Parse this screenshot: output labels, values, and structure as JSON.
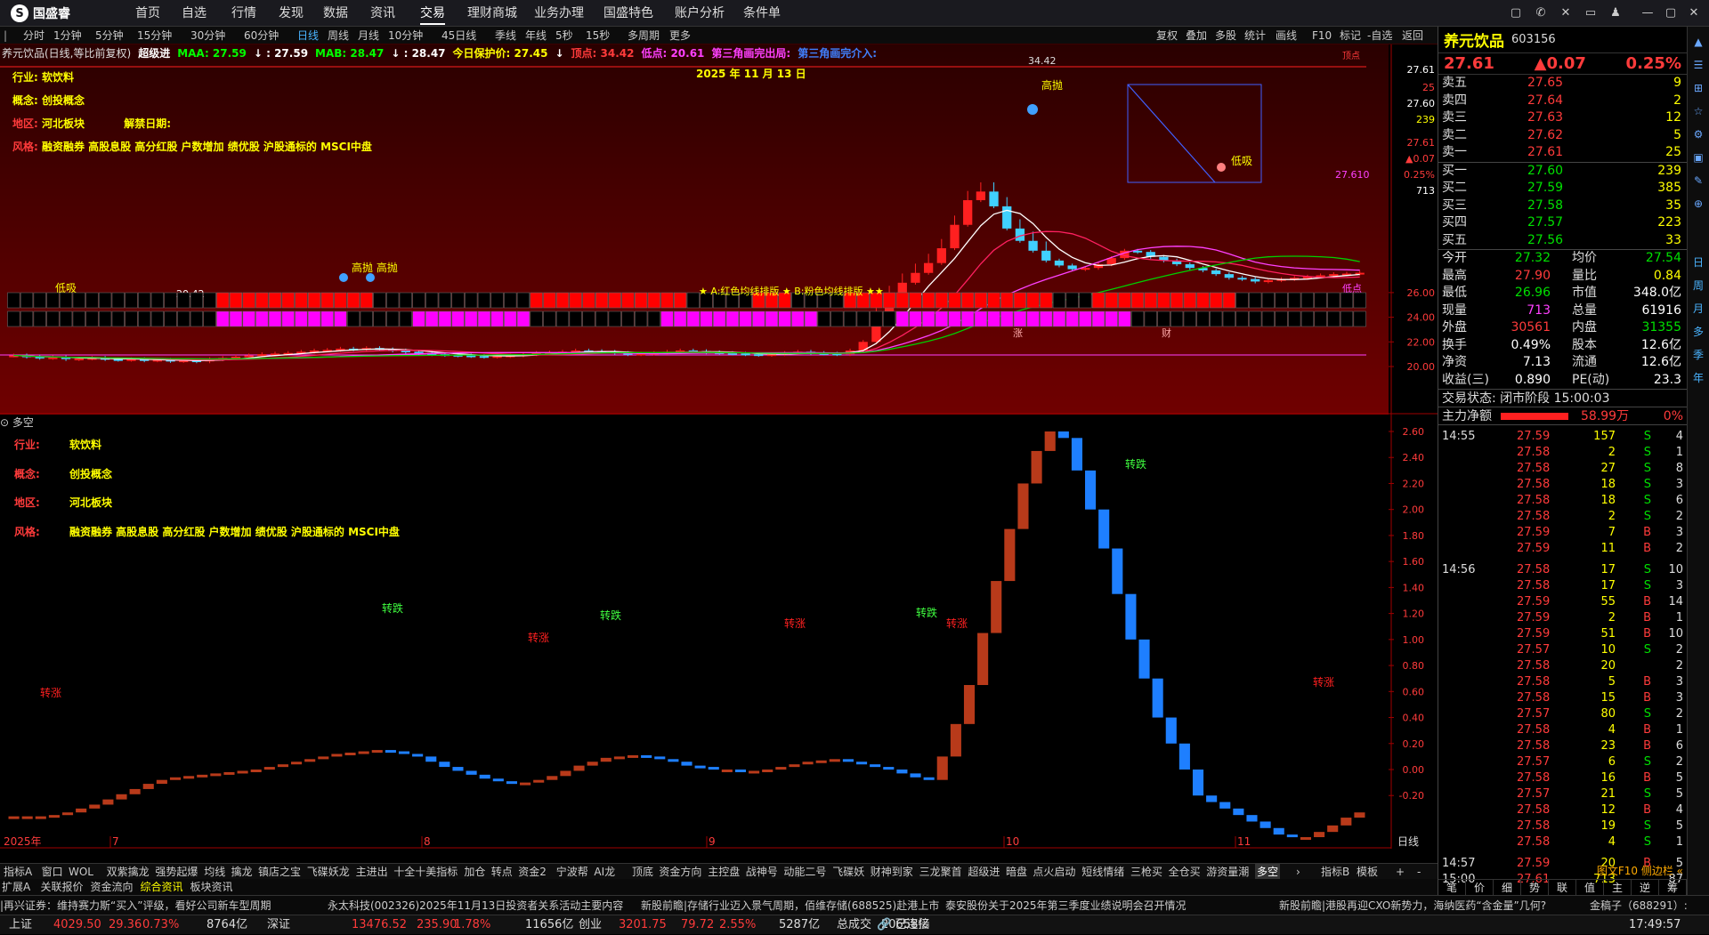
{
  "app": {
    "logo": "国盛睿"
  },
  "nav": [
    "首页",
    "自选",
    "行情",
    "发现",
    "数据",
    "资讯",
    "交易",
    "理财商城",
    "业务办理",
    "国盛特色",
    "账户分析",
    "条件单"
  ],
  "nav_active": "交易",
  "periods": [
    "分时",
    "1分钟",
    "5分钟",
    "15分钟",
    "30分钟",
    "60分钟",
    "日线",
    "周线",
    "月线",
    "10分钟",
    "45日线",
    "季线",
    "年线",
    "5秒",
    "15秒",
    "多周期",
    "更多"
  ],
  "period_active": "日线",
  "toolbar": [
    "复权",
    "叠加",
    "多股",
    "统计",
    "画线",
    "F10",
    "标记",
    "-自选",
    "返回"
  ],
  "chart_title": "养元饮品(日线,等比前复权)",
  "indicator_line": [
    {
      "t": "超级进",
      "c": "#ffffff"
    },
    {
      "t": "MAA: 27.59",
      "c": "#00ff00"
    },
    {
      "t": "↓ : 27.59",
      "c": "#ffffff"
    },
    {
      "t": "MAB: 28.47",
      "c": "#00ff00"
    },
    {
      "t": "↓ : 28.47",
      "c": "#ffffff"
    },
    {
      "t": "今日保护价: 27.45",
      "c": "#ffff00"
    },
    {
      "t": "↓",
      "c": "#ffffff"
    },
    {
      "t": "顶点: 34.42",
      "c": "#ff3b3b"
    },
    {
      "t": "低点: 20.61",
      "c": "#ff40ff"
    },
    {
      "t": "第三角画完出局:",
      "c": "#ff40ff"
    },
    {
      "t": "第三角画完介入:",
      "c": "#4080ff"
    }
  ],
  "info_block": {
    "labels": {
      "industry": "行业:",
      "concept": "概念:",
      "region": "地区:",
      "unban": "解禁日期:",
      "style": "风格:"
    },
    "industry": "软饮料",
    "concept": "创投概念",
    "region": "河北板块",
    "style": "融资融券 高股息股 高分红股 户数增加 绩优股 沪股通标的 MSCI中盘"
  },
  "date_label": "2025 年 11 月 13 日",
  "annotations": {
    "peak": "34.42",
    "low_val": "20.42",
    "high_sell": "高抛",
    "high_sell2": "高抛 高抛",
    "low_buy": "低吸",
    "last_price": "27.610",
    "pattern": "★ A:红色均线排版 ★ B:粉色均线排版 ★★",
    "top_mark": "顶点",
    "bottom_mark": "低点",
    "zhang": "涨",
    "cai": "财"
  },
  "price_axis": [
    "27.61",
    "25",
    "27.60",
    "239",
    "27.61",
    "▲0.07",
    "0.25%",
    "713",
    "26.00",
    "24.00",
    "22.00",
    "20.00"
  ],
  "lower": {
    "title": "多空",
    "axis": [
      "2.60",
      "2.40",
      "2.20",
      "2.00",
      "1.80",
      "1.60",
      "1.40",
      "1.20",
      "1.00",
      "0.80",
      "0.60",
      "0.40",
      "0.20",
      "0.00",
      "-0.20"
    ],
    "turn_down": "转跌",
    "turn_up": "转涨"
  },
  "months": [
    "2025年",
    "7",
    "8",
    "9",
    "10",
    "11"
  ],
  "indicator_tabs": [
    "指标A",
    "窗口",
    "WOL",
    "双紫擒龙",
    "强势起爆",
    "均线",
    "擒龙",
    "镇店之宝",
    "飞碟妖龙",
    "主进出",
    "十全十美指标",
    "加仓",
    "转点",
    "资金2",
    "宁波帮",
    "AI龙",
    "顶底",
    "资金方向",
    "主控盘",
    "战神号",
    "动能二号",
    "飞碟妖",
    "财神到家",
    "三龙聚首",
    "超级进",
    "暗盘",
    "点火启动",
    "短线情绪",
    "三枪买",
    "全仓买",
    "游资量潮",
    "多空",
    "指标B",
    "模板"
  ],
  "sub_tabs": [
    "扩展A",
    "关联报价",
    "资金流向",
    "综合资讯",
    "板块资讯"
  ],
  "news": [
    "|再兴证券：维持赛力斯“买入”评级，看好公司新车型周期",
    "永太科技(002326)2025年11月13日投资者关系活动主要内容",
    "新股前瞻|存储行业迈入景气周期，佰维存储(688525)赴港上市能否破",
    "泰安股份关于2025年第三季度业绩说明会召开情况",
    "新股前瞻|港股再迎CXO新势力，海纳医药“含金量”几何?",
    "金稿子（688291）:"
  ],
  "status": [
    {
      "n": "上证",
      "v": "4029.50",
      "c": "29.36",
      "p": "0.73%",
      "a": "8764亿"
    },
    {
      "n": "深证",
      "v": "13476.52",
      "c": "235.90",
      "p": "1.78%",
      "a": "11656亿"
    },
    {
      "n": "创业",
      "v": "3201.75",
      "c": "79.72",
      "p": "2.55%",
      "a": "5287亿"
    }
  ],
  "status_total_label": "总成交",
  "status_total": "20658亿",
  "connected": "已连接",
  "clock": "17:49:57",
  "quote": {
    "name": "养元饮品",
    "code": "603156",
    "price": "27.61",
    "change": "▲0.07",
    "pct": "0.25%",
    "asks": [
      [
        "卖五",
        "27.65",
        "9"
      ],
      [
        "卖四",
        "27.64",
        "2"
      ],
      [
        "卖三",
        "27.63",
        "12"
      ],
      [
        "卖二",
        "27.62",
        "5"
      ],
      [
        "卖一",
        "27.61",
        "25"
      ]
    ],
    "bids": [
      [
        "买一",
        "27.60",
        "239"
      ],
      [
        "买二",
        "27.59",
        "385"
      ],
      [
        "买三",
        "27.58",
        "35"
      ],
      [
        "买四",
        "27.57",
        "223"
      ],
      [
        "买五",
        "27.56",
        "33"
      ]
    ],
    "stats": [
      [
        "今开",
        "27.32",
        "均价",
        "27.54"
      ],
      [
        "最高",
        "27.90",
        "量比",
        "0.84"
      ],
      [
        "最低",
        "26.96",
        "市值",
        "348.0亿"
      ],
      [
        "现量",
        "713",
        "总量",
        "61916"
      ],
      [
        "外盘",
        "30561",
        "内盘",
        "31355"
      ],
      [
        "换手",
        "0.49%",
        "股本",
        "12.6亿"
      ],
      [
        "净资",
        "7.13",
        "流通",
        "12.6亿"
      ],
      [
        "收益(三)",
        "0.890",
        "PE(动)",
        "23.3"
      ]
    ],
    "trade_state": "交易状态: 闭市阶段 15:00:03",
    "mainflow_label": "主力净额",
    "mainflow": "58.99万",
    "mainflow_pct": "0%",
    "ticks": [
      [
        "14:55",
        "27.59",
        "157",
        "S",
        "4"
      ],
      [
        "",
        "27.58",
        "2",
        "S",
        "1"
      ],
      [
        "",
        "27.58",
        "27",
        "S",
        "8"
      ],
      [
        "",
        "27.58",
        "18",
        "S",
        "3"
      ],
      [
        "",
        "27.58",
        "18",
        "S",
        "6"
      ],
      [
        "",
        "27.58",
        "2",
        "S",
        "2"
      ],
      [
        "",
        "27.59",
        "7",
        "B",
        "3"
      ],
      [
        "",
        "27.59",
        "11",
        "B",
        "2"
      ],
      [
        "14:56",
        "27.58",
        "17",
        "S",
        "10"
      ],
      [
        "",
        "27.58",
        "17",
        "S",
        "3"
      ],
      [
        "",
        "27.59",
        "55",
        "B",
        "14"
      ],
      [
        "",
        "27.59",
        "2",
        "B",
        "1"
      ],
      [
        "",
        "27.59",
        "51",
        "B",
        "10"
      ],
      [
        "",
        "27.57",
        "10",
        "S",
        "2"
      ],
      [
        "",
        "27.58",
        "20",
        "",
        "2"
      ],
      [
        "",
        "27.58",
        "5",
        "B",
        "3"
      ],
      [
        "",
        "27.58",
        "15",
        "B",
        "3"
      ],
      [
        "",
        "27.57",
        "80",
        "S",
        "2"
      ],
      [
        "",
        "27.58",
        "4",
        "B",
        "1"
      ],
      [
        "",
        "27.58",
        "23",
        "B",
        "6"
      ],
      [
        "",
        "27.57",
        "6",
        "S",
        "2"
      ],
      [
        "",
        "27.58",
        "16",
        "B",
        "5"
      ],
      [
        "",
        "27.57",
        "21",
        "S",
        "5"
      ],
      [
        "",
        "27.58",
        "12",
        "B",
        "4"
      ],
      [
        "",
        "27.58",
        "19",
        "S",
        "5"
      ],
      [
        "",
        "27.58",
        "4",
        "S",
        "1"
      ],
      [
        "14:57",
        "27.59",
        "20",
        "B",
        "5"
      ],
      [
        "15:00",
        "27.61",
        "713",
        "",
        "87"
      ]
    ],
    "tabs": [
      "笔",
      "价",
      "细",
      "势",
      "联",
      "值",
      "主",
      "逆",
      "筹"
    ],
    "bottom_links": "图文F10 侧边栏 «"
  },
  "side_icons": [
    "▲",
    "☰",
    "⊞",
    "☆",
    "⚙",
    "▣",
    "✎",
    "⊕",
    "日",
    "周",
    "月",
    "多",
    "季",
    "年"
  ]
}
